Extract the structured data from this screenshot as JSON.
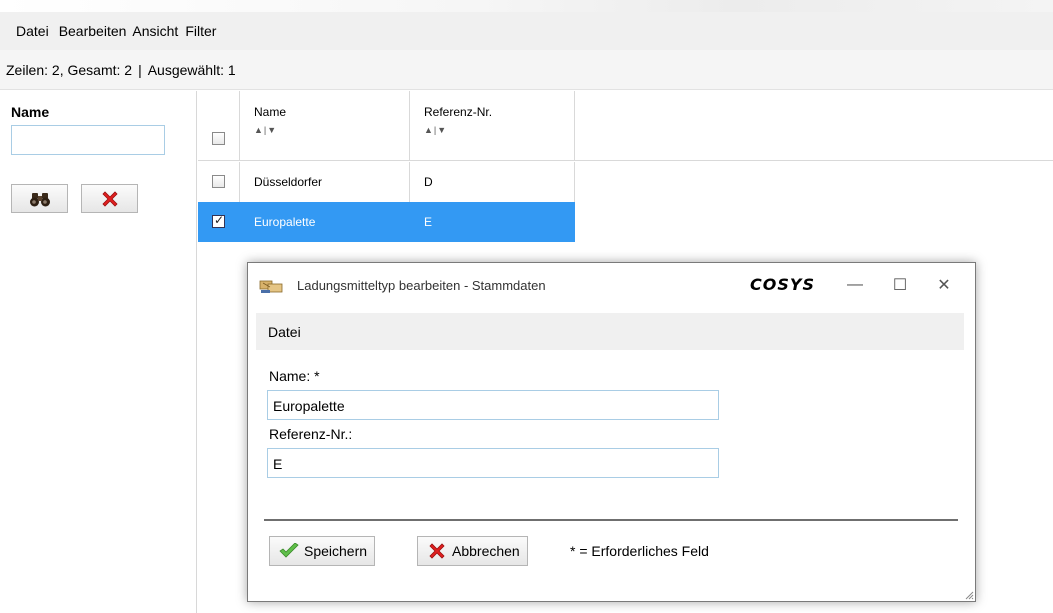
{
  "menubar": {
    "items": [
      "Datei",
      "Bearbeiten",
      "Ansicht",
      "Filter"
    ]
  },
  "status": {
    "rows": "Zeilen: 2, Gesamt: 2",
    "separator": "|",
    "selected": "Ausgewählt: 1"
  },
  "filter": {
    "name_label": "Name",
    "name_value": "",
    "search_icon": "binoculars-icon",
    "clear_icon": "red-x-icon"
  },
  "grid": {
    "columns": [
      {
        "label": "Name",
        "sort": "▲|▼"
      },
      {
        "label": "Referenz-Nr.",
        "sort": "▲|▼"
      }
    ],
    "rows": [
      {
        "name": "Düsseldorfer",
        "ref": "D",
        "checked": false,
        "selected": false
      },
      {
        "name": "Europalette",
        "ref": "E",
        "checked": true,
        "selected": true
      }
    ],
    "selection_color": "#3399f3"
  },
  "dialog": {
    "title": "Ladungsmitteltyp bearbeiten - Stammdaten",
    "brand": "COSYS",
    "controls": {
      "minimize": "—",
      "maximize": "☐",
      "close": "✕"
    },
    "menu": "Datei",
    "fields": [
      {
        "label": "Name: *",
        "value": "Europalette"
      },
      {
        "label": "Referenz-Nr.:",
        "value": "E"
      }
    ],
    "save_label": "Speichern",
    "cancel_label": "Abbrechen",
    "required_note": "* = Erforderliches Feld"
  }
}
